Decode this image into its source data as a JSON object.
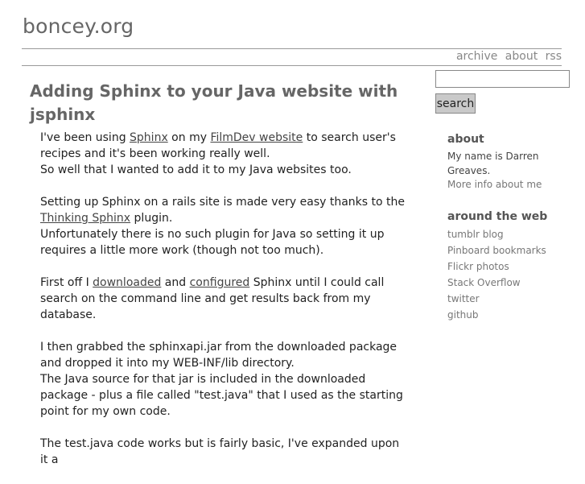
{
  "site": {
    "title": "boncey.org"
  },
  "nav": {
    "archive": "archive",
    "about": "about",
    "rss": "rss"
  },
  "post": {
    "title": "Adding Sphinx to your Java website with jsphinx",
    "p1": {
      "t1": "I've been using ",
      "link1": "Sphinx",
      "t2": " on my ",
      "link2": "FilmDev website",
      "t3": " to search user's recipes and it's been working really well.",
      "t4": "So well that I wanted to add it to my Java websites too."
    },
    "p2": {
      "t1": "Setting up Sphinx on a rails site is made very easy thanks to the ",
      "link1": "Thinking Sphinx",
      "t2": " plugin.",
      "t3": "Unfortunately there is no such plugin for Java so setting it up requires a little more work (though not too much)."
    },
    "p3": {
      "t1": "First off I ",
      "link1": "downloaded",
      "t2": " and ",
      "link2": "configured",
      "t3": " Sphinx until I could call search on the command line and get results back from my database."
    },
    "p4": {
      "t1": "I then grabbed the sphinxapi.jar from the downloaded package and dropped it into my WEB-INF/lib directory.",
      "t2": "The Java source for that jar is included in the downloaded package - plus a file called \"test.java\" that I used as the starting point for my own code."
    },
    "p5": {
      "t1": "The test.java code works but is fairly basic, I've expanded upon it a"
    }
  },
  "search": {
    "placeholder": "",
    "button_label": "search"
  },
  "sidebar": {
    "about": {
      "heading": "about",
      "text": "My name is Darren Greaves.",
      "more_link": "More info about me"
    },
    "web": {
      "heading": "around the web",
      "links": [
        "tumblr blog",
        "Pinboard bookmarks",
        "Flickr photos",
        "Stack Overflow",
        "twitter",
        "github"
      ]
    }
  }
}
